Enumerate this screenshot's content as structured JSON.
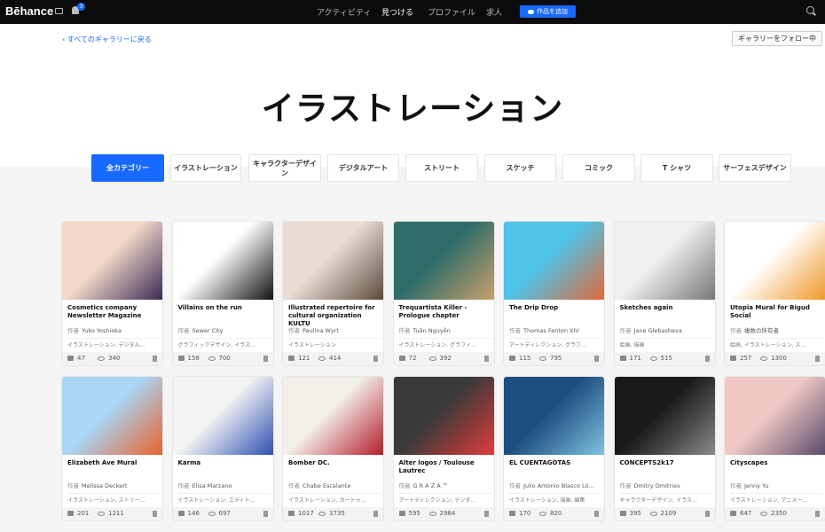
{
  "topbar": {
    "logo": "Bēhance",
    "notif_count": "3",
    "nav": [
      "アクティビティ",
      "見つける",
      "プロファイル",
      "求人"
    ],
    "add_work": "作品を追加"
  },
  "hero": {
    "back_link": "すべてのギャラリーに戻る",
    "follow_button": "ギャラリーをフォロー中",
    "title": "イラストレーション"
  },
  "categories": [
    "全カテゴリー",
    "イラストレーション",
    "キャラクターデザイン",
    "デジタルアート",
    "ストリート",
    "スケッチ",
    "コミック",
    "T シャツ",
    "サーフェスデザイン"
  ],
  "by_label": "作者",
  "projects": [
    {
      "title": "Cosmetics company Newsletter Magazine",
      "owner": "Yuko Yoshioka",
      "fields": "イラストレーション, デジタル…",
      "likes": "47",
      "views": "340",
      "c1": "#f3d9c7",
      "c2": "#3a2a55"
    },
    {
      "title": "Villains on the run",
      "owner": "Sewer City",
      "fields": "グラフィックデザイン, イラス…",
      "likes": "158",
      "views": "700",
      "c1": "#ffffff",
      "c2": "#111111"
    },
    {
      "title": "Illustrated repertoire for cultural organization KULTU",
      "owner": "Paulina Wyrt",
      "fields": "イラストレーション",
      "likes": "121",
      "views": "414",
      "c1": "#e8dcd3",
      "c2": "#5c4a3c"
    },
    {
      "title": "Trequartista Killer - Prologue chapter",
      "owner": "Tuấn Nguyễn",
      "fields": "イラストレーション, グラフィ…",
      "likes": "72",
      "views": "392",
      "c1": "#2f6d6a",
      "c2": "#c9a06a"
    },
    {
      "title": "The Drip Drop",
      "owner": "Thomas Fenton XIV",
      "fields": "アートディレクション, グラフ…",
      "likes": "115",
      "views": "795",
      "c1": "#4fc3e8",
      "c2": "#e06a3a"
    },
    {
      "title": "Sketches again",
      "owner": "Jane Glebasheva",
      "fields": "絵画, 描画",
      "likes": "171",
      "views": "515",
      "c1": "#efefef",
      "c2": "#777777"
    },
    {
      "title": "Utopia Mural for Bigud Social",
      "owner": "複数の所有者",
      "fields": "絵画, イラストレーション, ス…",
      "likes": "257",
      "views": "1300",
      "c1": "#ffffff",
      "c2": "#f09a2c"
    },
    {
      "title": "Elizabeth Ave Mural",
      "owner": "Melissa Deckert",
      "fields": "イラストレーション, ストリー…",
      "likes": "201",
      "views": "1211",
      "c1": "#a9d6f5",
      "c2": "#e8622c"
    },
    {
      "title": "Karma",
      "owner": "Elisa Marzano",
      "fields": "イラストレーション, エディト…",
      "likes": "146",
      "views": "697",
      "c1": "#f4f4f4",
      "c2": "#2d4fb0"
    },
    {
      "title": "Bomber DC.",
      "owner": "Chabe Escalante",
      "fields": "イラストレーション, カートゥ…",
      "likes": "1017",
      "views": "3735",
      "c1": "#f2eee8",
      "c2": "#b31d2a"
    },
    {
      "title": "Alter logos / Toulouse Lautrec",
      "owner": "G R A Z A ™",
      "fields": "アートディレクション, デジタ…",
      "likes": "595",
      "views": "2984",
      "c1": "#3a3a3a",
      "c2": "#e23b3b"
    },
    {
      "title": "EL CUENTAGOTAS",
      "owner": "Julio Antonio Blasco Ló…",
      "fields": "イラストレーション, 描画, 編集",
      "likes": "170",
      "views": "820",
      "c1": "#1d4e80",
      "c2": "#7fc3e0"
    },
    {
      "title": "CONCEPTS2k17",
      "owner": "Dmitry Dmitriev",
      "fields": "キャラクターデザイン, イラス…",
      "likes": "395",
      "views": "2109",
      "c1": "#1a1a1a",
      "c2": "#8a8a8a"
    },
    {
      "title": "Cityscapes",
      "owner": "Jenny Yu",
      "fields": "イラストレーション, アニメー…",
      "likes": "647",
      "views": "2350",
      "c1": "#f0c9c4",
      "c2": "#5a4a6a"
    }
  ]
}
